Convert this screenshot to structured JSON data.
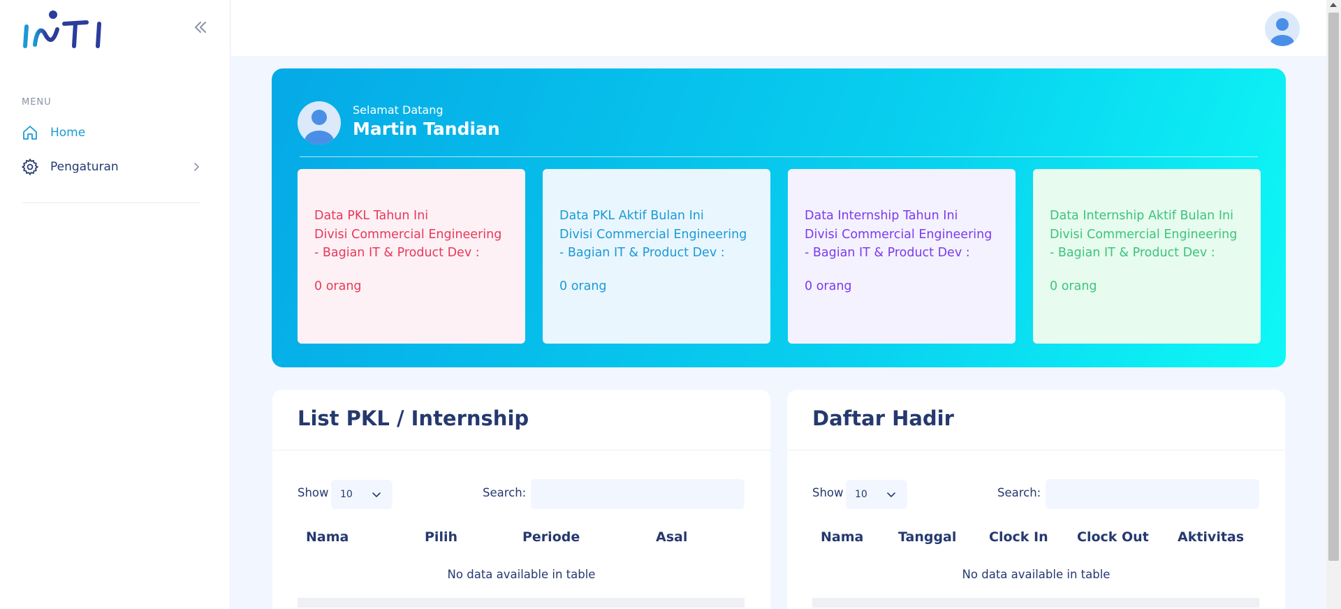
{
  "app": {
    "brand": "INTI"
  },
  "sidebar": {
    "menu_title": "MENU",
    "items": [
      {
        "label": "Home",
        "icon": "home-icon",
        "active": true
      },
      {
        "label": "Pengaturan",
        "icon": "gear-icon",
        "has_submenu": true
      }
    ]
  },
  "hero": {
    "greeting": "Selamat Datang",
    "user_name": "Martin Tandian",
    "cards": [
      {
        "line1": "Data PKL Tahun Ini",
        "line2": "Divisi Commercial Engineering",
        "line3": "- Bagian IT & Product Dev :",
        "value": "0 orang",
        "color": "#e8385a"
      },
      {
        "line1": "Data PKL Aktif Bulan Ini",
        "line2": "Divisi Commercial Engineering",
        "line3": "- Bagian IT & Product Dev :",
        "value": "0 orang",
        "color": "#1a9ad6"
      },
      {
        "line1": "Data Internship Tahun Ini",
        "line2": "Divisi Commercial Engineering",
        "line3": "- Bagian IT & Product Dev :",
        "value": "0 orang",
        "color": "#7c3aed"
      },
      {
        "line1": "Data Internship Aktif Bulan Ini",
        "line2": "Divisi Commercial Engineering",
        "line3": "- Bagian IT & Product Dev :",
        "value": "0 orang",
        "color": "#3cc47c"
      }
    ]
  },
  "pkl_table": {
    "title": "List PKL / Internship",
    "show_label": "Show",
    "page_size": "10",
    "search_label": "Search:",
    "columns": [
      "Nama",
      "Pilih",
      "Periode",
      "Asal"
    ],
    "empty_text": "No data available in table"
  },
  "attendance_table": {
    "title": "Daftar Hadir",
    "show_label": "Show",
    "page_size": "10",
    "search_label": "Search:",
    "columns": [
      "Nama",
      "Tanggal",
      "Clock In",
      "Clock Out",
      "Aktivitas"
    ],
    "empty_text": "No data available in table"
  }
}
